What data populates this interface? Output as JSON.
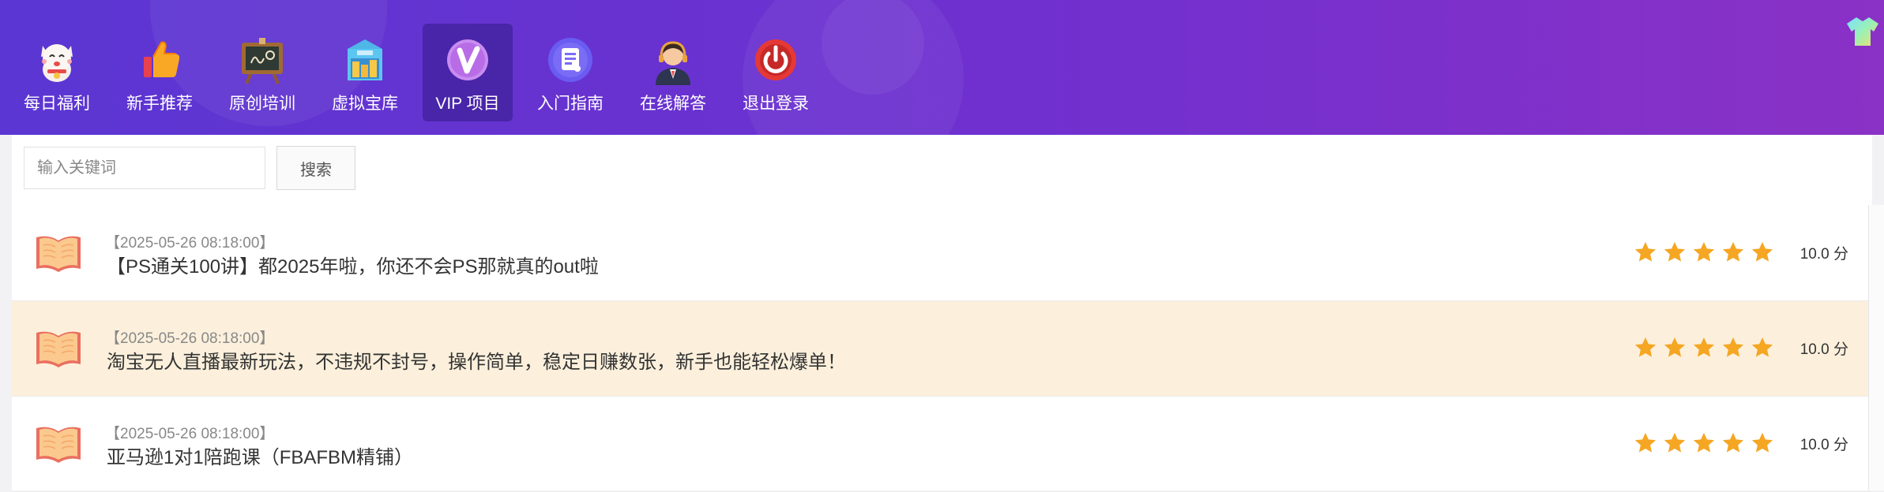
{
  "nav": {
    "items": [
      {
        "label": "每日福利",
        "icon": "lucky-cat-icon"
      },
      {
        "label": "新手推荐",
        "icon": "thumbs-up-icon"
      },
      {
        "label": "原创培训",
        "icon": "chalkboard-icon"
      },
      {
        "label": "虚拟宝库",
        "icon": "treasure-box-icon"
      },
      {
        "label": "VIP 项目",
        "icon": "vip-badge-icon",
        "active": true
      },
      {
        "label": "入门指南",
        "icon": "document-icon"
      },
      {
        "label": "在线解答",
        "icon": "support-agent-icon"
      },
      {
        "label": "退出登录",
        "icon": "power-icon"
      }
    ]
  },
  "search": {
    "placeholder": "输入关键词",
    "value": "",
    "button_label": "搜索"
  },
  "articles": [
    {
      "date": "【2025-05-26 08:18:00】",
      "title": "【PS通关100讲】都2025年啦，你还不会PS那就真的out啦",
      "stars": 5,
      "score": "10.0 分",
      "highlight": false
    },
    {
      "date": "【2025-05-26 08:18:00】",
      "title": "淘宝无人直播最新玩法，不违规不封号，操作简单，稳定日赚数张，新手也能轻松爆单！",
      "stars": 5,
      "score": "10.0 分",
      "highlight": true
    },
    {
      "date": "【2025-05-26 08:18:00】",
      "title": "亚马逊1对1陪跑课（FBAFBM精铺）",
      "stars": 5,
      "score": "10.0 分",
      "highlight": false
    }
  ],
  "colors": {
    "header_gradient_start": "#5b36d2",
    "header_gradient_end": "#8a31c6",
    "star": "#f5a623",
    "highlight_row": "#fcf0dc"
  }
}
